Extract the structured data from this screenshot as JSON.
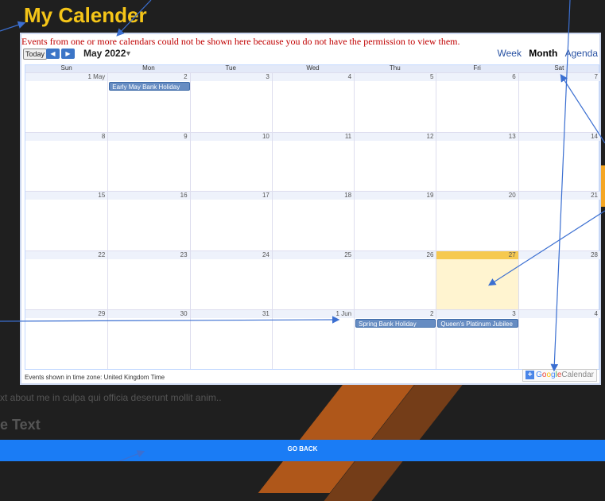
{
  "page": {
    "title": "My Calender"
  },
  "calendar": {
    "notice": "Events from one or more calendars could not be shown here because you do not have the permission to view them.",
    "today_label": "Today",
    "month_label": "May 2022",
    "views": [
      "Week",
      "Month",
      "Agenda"
    ],
    "active_view": "Month",
    "weekdays": [
      "Sun",
      "Mon",
      "Tue",
      "Wed",
      "Thu",
      "Fri",
      "Sat"
    ],
    "weeks": [
      [
        "1 May",
        "2",
        "3",
        "4",
        "5",
        "6",
        "7"
      ],
      [
        "8",
        "9",
        "10",
        "11",
        "12",
        "13",
        "14"
      ],
      [
        "15",
        "16",
        "17",
        "18",
        "19",
        "20",
        "21"
      ],
      [
        "22",
        "23",
        "24",
        "25",
        "26",
        "27",
        "28"
      ],
      [
        "29",
        "30",
        "31",
        "1 Jun",
        "2",
        "3",
        "4"
      ]
    ],
    "today": "27",
    "events": {
      "early_may": "Early May Bank Holiday",
      "spring": "Spring Bank Holiday",
      "jubilee": "Queen's Platinum Jubilee"
    },
    "timezone_note": "Events shown in time zone: United Kingdom Time",
    "google_badge": {
      "google": [
        "G",
        "o",
        "o",
        "g",
        "l",
        "e"
      ],
      "suffix": "Calendar"
    }
  },
  "below": {
    "about_text": "xt about me in culpa qui officia deserunt mollit anim..",
    "heading": "e Text",
    "go_back": "GO BACK"
  },
  "colors": {
    "title": "#f5c518",
    "go_back": "#1a7cf5",
    "today_cell": "#fff4d0",
    "event": "#668cc2"
  }
}
